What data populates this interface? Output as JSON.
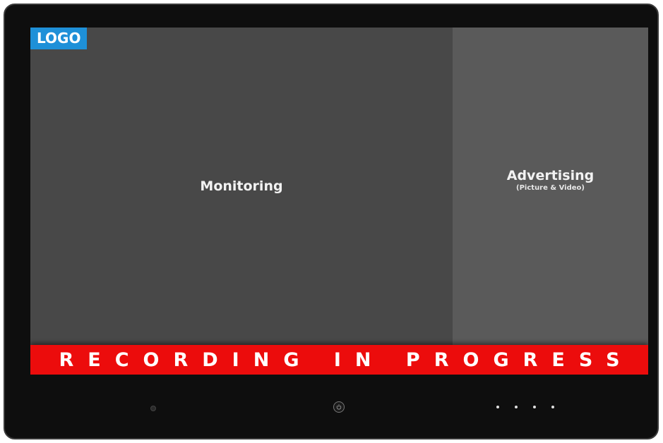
{
  "screen": {
    "logo_text": "LOGO",
    "monitoring": {
      "title": "Monitoring"
    },
    "advertising": {
      "title": "Advertising",
      "subtitle": "(Picture & Video)"
    },
    "banner": {
      "text": "RECORDING IN PROGRESS"
    }
  },
  "bezel": {
    "controls": {
      "camera": "camera-icon",
      "power": "power-icon",
      "indicators": "indicator-dots"
    }
  },
  "colors": {
    "logo_background": "#1e90d8",
    "banner_background": "#ec0c0c",
    "monitoring_background": "#484848",
    "advertising_background": "#5a5a5a",
    "bezel": "#0e0e0e"
  }
}
